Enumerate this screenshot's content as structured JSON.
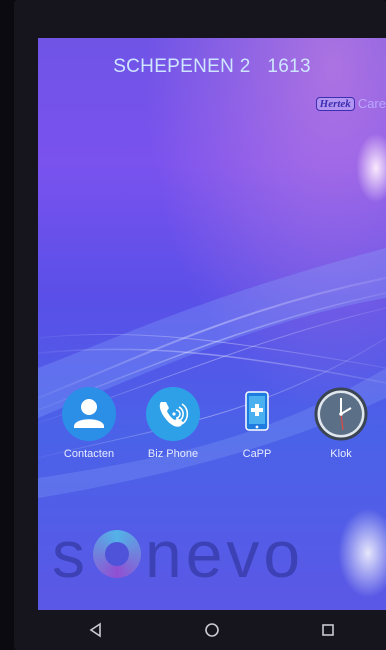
{
  "header": {
    "location": "SCHEPENEN 2",
    "room": "1613",
    "brand_logo": "Hertek",
    "brand_suffix": "Care"
  },
  "apps": [
    {
      "label": "Contacten",
      "icon": "contact-person-icon"
    },
    {
      "label": "Biz Phone",
      "icon": "phone-handset-icon"
    },
    {
      "label": "CaPP",
      "icon": "capp-device-icon"
    },
    {
      "label": "Klok",
      "icon": "clock-icon"
    }
  ],
  "wallpaper_text": "sonevo",
  "navbar": {
    "back": "back-icon",
    "home": "home-icon",
    "recents": "recents-icon"
  },
  "colors": {
    "accent_blue": "#2b8fe8",
    "header_text": "#cfe6ff",
    "wallpaper_top": "#7a52ee",
    "wallpaper_bottom": "#4a62e8"
  }
}
